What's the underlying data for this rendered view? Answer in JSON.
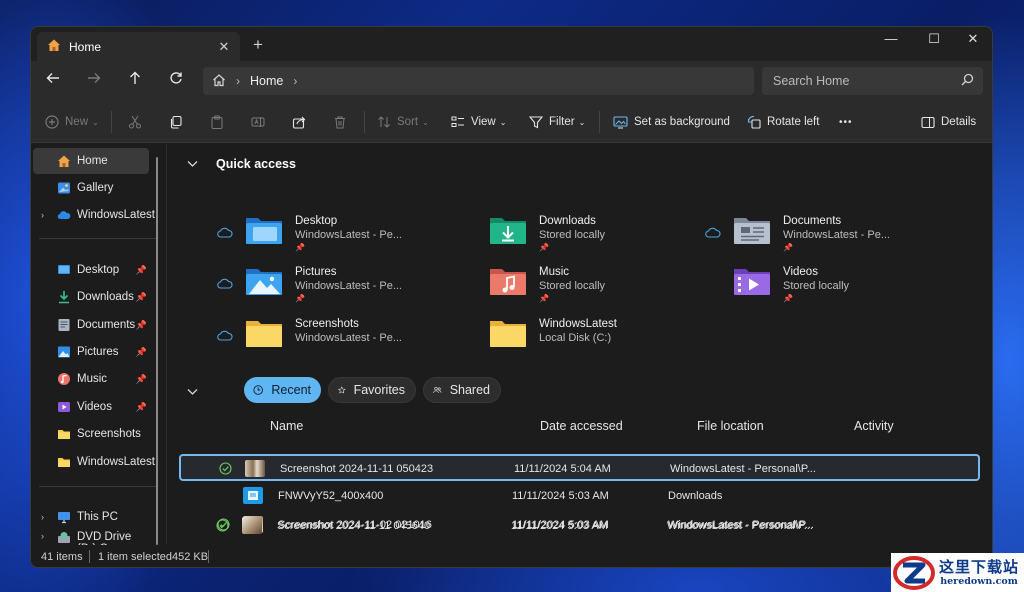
{
  "colors": {
    "accent": "#5fb6f3",
    "selection_border": "#75b9f0",
    "window_bg": "#1c1c1c",
    "chrome_bg": "#2b2b2b",
    "sync_green": "#6ccb5f",
    "cloud_blue": "#4aa3e8"
  },
  "tab": {
    "label": "Home",
    "icon": "home-icon"
  },
  "window_controls": {
    "new_tab": "+",
    "minimize": "—",
    "maximize": "☐",
    "close": "✕"
  },
  "address": {
    "breadcrumb": "Home"
  },
  "search": {
    "placeholder": "Search Home"
  },
  "toolbar": {
    "new_label": "New",
    "sort_label": "Sort",
    "view_label": "View",
    "filter_label": "Filter",
    "set_background_label": "Set as background",
    "rotate_left_label": "Rotate left",
    "more_label": "•••",
    "details_label": "Details"
  },
  "sidebar": {
    "top": [
      {
        "label": "Home",
        "icon": "home-icon",
        "selected": true
      },
      {
        "label": "Gallery",
        "icon": "gallery-icon"
      },
      {
        "label": "WindowsLatest",
        "icon": "onedrive-icon"
      }
    ],
    "pinned": [
      {
        "label": "Desktop",
        "icon": "desktop-icon"
      },
      {
        "label": "Downloads",
        "icon": "downloads-icon"
      },
      {
        "label": "Documents",
        "icon": "documents-icon"
      },
      {
        "label": "Pictures",
        "icon": "pictures-icon"
      },
      {
        "label": "Music",
        "icon": "music-icon"
      },
      {
        "label": "Videos",
        "icon": "videos-icon"
      },
      {
        "label": "Screenshots",
        "icon": "folder-icon"
      },
      {
        "label": "WindowsLatest",
        "icon": "folder-icon"
      }
    ],
    "bottom": [
      {
        "label": "This PC",
        "icon": "pc-icon"
      },
      {
        "label": "DVD Drive (D:) C",
        "icon": "dvd-icon"
      }
    ]
  },
  "quick_access": {
    "title": "Quick access",
    "items": [
      {
        "name": "Desktop",
        "sub": "WindowsLatest - Pe...",
        "cloud": true
      },
      {
        "name": "Downloads",
        "sub": "Stored locally",
        "cloud": false
      },
      {
        "name": "Documents",
        "sub": "WindowsLatest - Pe...",
        "cloud": true
      },
      {
        "name": "Pictures",
        "sub": "WindowsLatest - Pe...",
        "cloud": true
      },
      {
        "name": "Music",
        "sub": "Stored locally",
        "cloud": false
      },
      {
        "name": "Videos",
        "sub": "Stored locally",
        "cloud": false
      },
      {
        "name": "Screenshots",
        "sub": "WindowsLatest - Pe...",
        "cloud": true
      },
      {
        "name": "WindowsLatest",
        "sub": "Local Disk (C:)",
        "cloud": false
      }
    ]
  },
  "recent_tabs": [
    {
      "label": "Recent",
      "active": true
    },
    {
      "label": "Favorites",
      "active": false
    },
    {
      "label": "Shared",
      "active": false
    }
  ],
  "columns": {
    "name": "Name",
    "date": "Date accessed",
    "location": "File location",
    "activity": "Activity"
  },
  "files": [
    {
      "name": "Screenshot 2024-11-11 050423",
      "date": "11/11/2024 5:04 AM",
      "location": "WindowsLatest - Personal\\P...",
      "synced": true,
      "selected": true
    },
    {
      "name": "FNWVyY52_400x400",
      "date": "11/11/2024 5:03 AM",
      "location": "Downloads",
      "synced": false,
      "selected": false
    },
    {
      "name": "Screenshot 2024-11-02 021016",
      "date": "11/11/2024 5:03 AM",
      "location": "WindowsLatest - Personal\\P...",
      "synced": true,
      "selected": false
    },
    {
      "name": "Screenshot 2024-11-11 045640",
      "date": "11/11/2024 5:03 AM",
      "location": "WindowsLatest - Personal\\P...",
      "synced": true,
      "selected": false
    }
  ],
  "status": {
    "count": "41 items",
    "selection": "1 item selected",
    "size": "452 KB"
  },
  "watermark": {
    "cn": "这里下载站",
    "en": "heredown.com"
  }
}
